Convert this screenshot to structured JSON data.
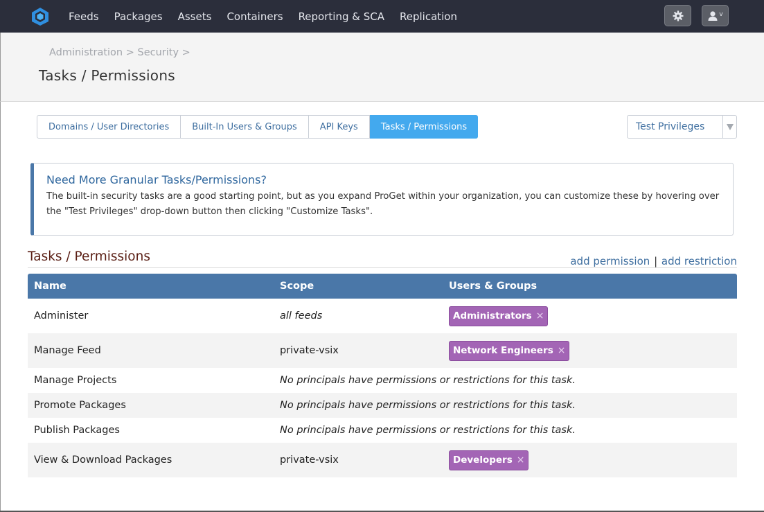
{
  "nav": {
    "logo": "proget-logo",
    "links": [
      "Feeds",
      "Packages",
      "Assets",
      "Containers",
      "Reporting & SCA",
      "Replication"
    ],
    "settings_icon": "gear-icon",
    "user_icon": "user-icon",
    "user_caret": "v"
  },
  "header": {
    "breadcrumb": [
      "Administration",
      "Security"
    ],
    "breadcrumb_sep": ">",
    "title": "Tasks / Permissions"
  },
  "tabs": [
    {
      "label": "Domains / User Directories",
      "active": false
    },
    {
      "label": "Built-In Users & Groups",
      "active": false
    },
    {
      "label": "API Keys",
      "active": false
    },
    {
      "label": "Tasks / Permissions",
      "active": true
    }
  ],
  "privilege_select": {
    "label": "Test Privileges",
    "icon": "chevron-down-icon"
  },
  "info": {
    "title": "Need More Granular Tasks/Permissions?",
    "text": "The built-in security tasks are a good starting point, but as you expand ProGet within your organization, you can customize these by hovering over the \"Test Privileges\" drop-down button then clicking \"Customize Tasks\"."
  },
  "section": {
    "title": "Tasks / Permissions",
    "add_permission": "add permission",
    "separator": "|",
    "add_restriction": "add restriction"
  },
  "table": {
    "headers": [
      "Name",
      "Scope",
      "Users & Groups"
    ],
    "rows": [
      {
        "name": "Administer",
        "scope": "all feeds",
        "scope_italic": true,
        "principals": [
          "Administrators"
        ],
        "message": ""
      },
      {
        "name": "Manage Feed",
        "scope": "private-vsix",
        "scope_italic": false,
        "principals": [
          "Network Engineers"
        ],
        "message": ""
      },
      {
        "name": "Manage Projects",
        "scope": "",
        "principals": [],
        "message": "No principals have permissions or restrictions for this task."
      },
      {
        "name": "Promote Packages",
        "scope": "",
        "principals": [],
        "message": "No principals have permissions or restrictions for this task."
      },
      {
        "name": "Publish Packages",
        "scope": "",
        "principals": [],
        "message": "No principals have permissions or restrictions for this task."
      },
      {
        "name": "View & Download Packages",
        "scope": "private-vsix",
        "scope_italic": false,
        "principals": [
          "Developers"
        ],
        "message": ""
      }
    ],
    "remove_glyph": "×"
  },
  "colors": {
    "nav_bg": "#2b2e3b",
    "accent": "#43a9ee",
    "table_header": "#4a77a8",
    "chip": "#a365b5",
    "section_title": "#5a1e14"
  }
}
